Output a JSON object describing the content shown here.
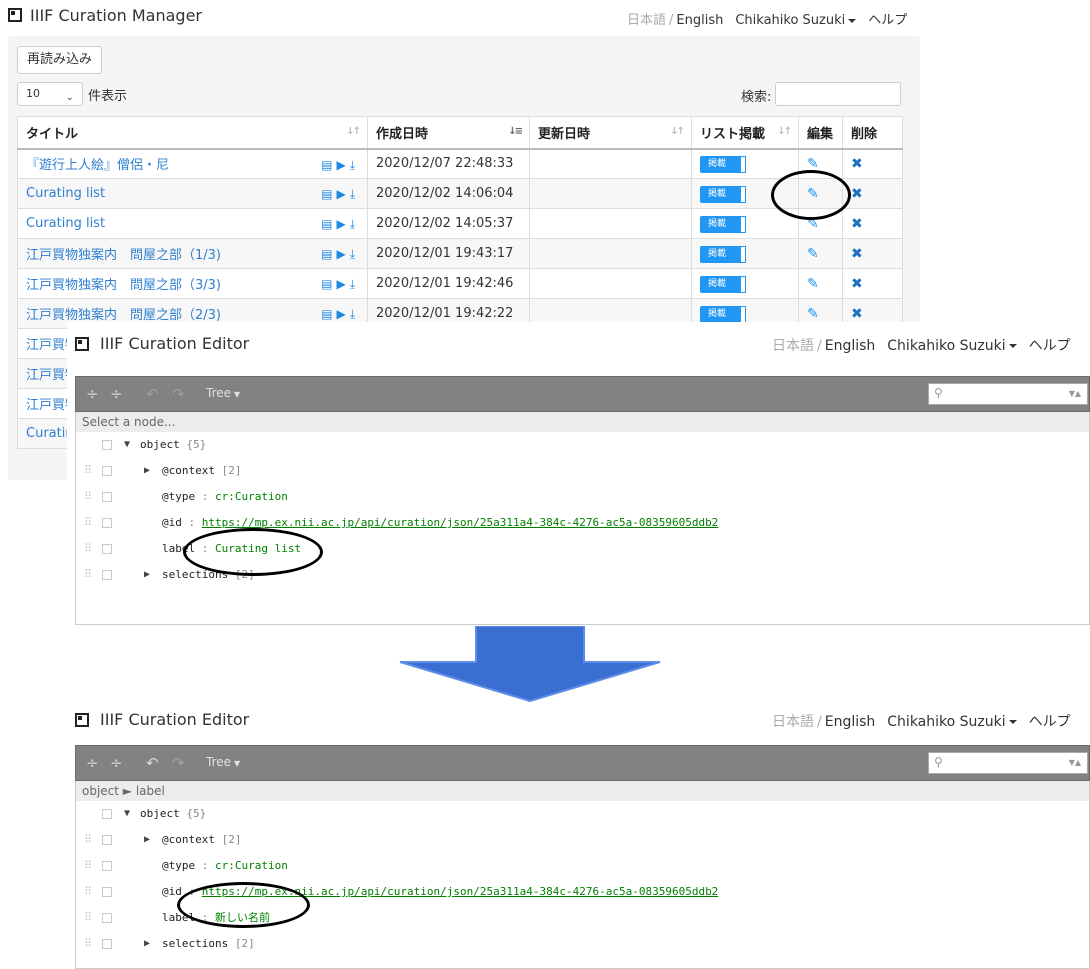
{
  "manager": {
    "brand": "IIIF Curation Manager",
    "nav": {
      "lang_ja": "日本語",
      "sep": "/",
      "lang_en": "English",
      "user": "Chikahiko Suzuki",
      "help": "ヘルプ"
    },
    "reload_label": "再読み込み",
    "page_length": "10",
    "page_length_suffix": "件表示",
    "search_label": "検索:",
    "columns": [
      "タイトル",
      "作成日時",
      "更新日時",
      "リスト掲載",
      "編集",
      "削除"
    ],
    "rows": [
      {
        "title": "『遊行上人絵』僧侶・尼",
        "created": "2020/12/07 22:48:33",
        "updated": "",
        "listed": "掲載"
      },
      {
        "title": "Curating list",
        "created": "2020/12/02 14:06:04",
        "updated": "",
        "listed": "掲載"
      },
      {
        "title": "Curating list",
        "created": "2020/12/02 14:05:37",
        "updated": "",
        "listed": "掲載"
      },
      {
        "title": "江戸買物独案内　問屋之部（1/3)",
        "created": "2020/12/01 19:43:17",
        "updated": "",
        "listed": "掲載"
      },
      {
        "title": "江戸買物独案内　問屋之部（3/3)",
        "created": "2020/12/01 19:42:46",
        "updated": "",
        "listed": "掲載"
      },
      {
        "title": "江戸買物独案内　問屋之部（2/3)",
        "created": "2020/12/01 19:42:22",
        "updated": "",
        "listed": "掲載"
      },
      {
        "title": "江戸買物",
        "created": "",
        "updated": "",
        "listed": ""
      },
      {
        "title": "江戸買物",
        "created": "",
        "updated": "",
        "listed": ""
      },
      {
        "title": "江戸買物",
        "created": "",
        "updated": "",
        "listed": ""
      },
      {
        "title": "Curating",
        "created": "",
        "updated": "",
        "listed": ""
      }
    ]
  },
  "editor_before": {
    "brand": "IIIF Curation Editor",
    "nav": {
      "lang_ja": "日本語",
      "sep": "/",
      "lang_en": "English",
      "user": "Chikahiko Suzuki",
      "help": "ヘルプ"
    },
    "toolbar_mode": "Tree",
    "nav_text": "Select a node...",
    "tree": {
      "root": "object",
      "root_count": "{5}",
      "context_key": "@context",
      "context_count": "[2]",
      "type_key": "@type",
      "type_value": "cr:Curation",
      "id_key": "@id",
      "id_value": "https://mp.ex.nii.ac.jp/api/curation/json/25a311a4-384c-4276-ac5a-08359605ddb2",
      "label_key": "label",
      "label_value": "Curating list",
      "selections_key": "selections",
      "selections_count": "[2]"
    }
  },
  "editor_after": {
    "brand": "IIIF Curation Editor",
    "nav": {
      "lang_ja": "日本語",
      "sep": "/",
      "lang_en": "English",
      "user": "Chikahiko Suzuki",
      "help": "ヘルプ"
    },
    "toolbar_mode": "Tree",
    "nav_text": "object ► label",
    "tree": {
      "root": "object",
      "root_count": "{5}",
      "context_key": "@context",
      "context_count": "[2]",
      "type_key": "@type",
      "type_value": "cr:Curation",
      "id_key": "@id",
      "id_value": "https://mp.ex.nii.ac.jp/api/curation/json/25a311a4-384c-4276-ac5a-08359605ddb2",
      "label_key": "label",
      "label_value": "新しい名前",
      "selections_key": "selections",
      "selections_count": "[2]"
    }
  },
  "colors": {
    "link": "#2f7fd1",
    "accent": "#2196f3",
    "toolbar": "#828282",
    "json_string": "#008000",
    "arrow": "#3a6fd1"
  },
  "icons": {
    "logo": "square-logo-icon",
    "row_actions": [
      "viewer-icon",
      "play-icon",
      "download-icon"
    ],
    "edit": "edit-icon",
    "delete": "delete-icon"
  }
}
